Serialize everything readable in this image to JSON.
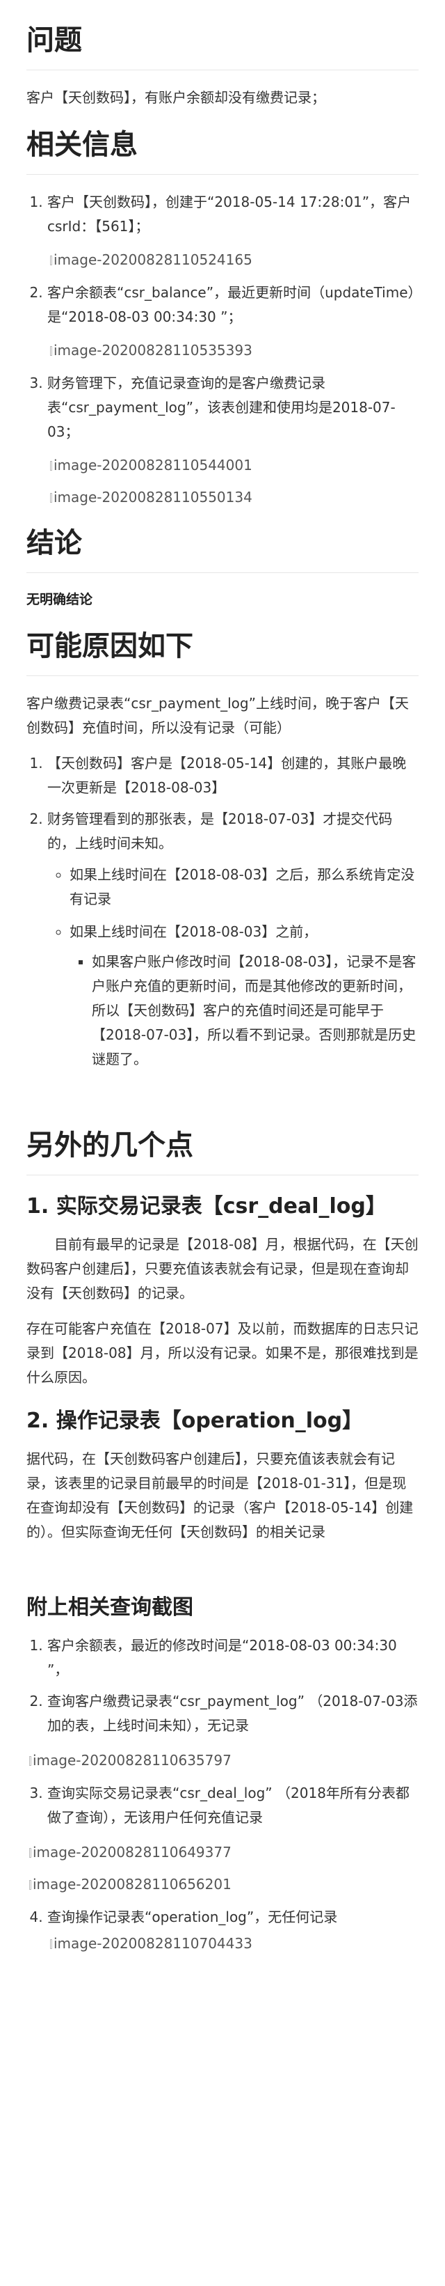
{
  "s1": {
    "title": "问题",
    "body": "客户【天创数码】，有账户余额却没有缴费记录；"
  },
  "s2": {
    "title": "相关信息",
    "items": [
      {
        "text": "客户【天创数码】，创建于“2018-05-14 17:28:01”，客户csrId：【561】；",
        "img": "image-20200828110524165"
      },
      {
        "text": "客户余额表“csr_balance”，最近更新时间（updateTime）是“2018-08-03 00:34:30 ”；",
        "img": "image-20200828110535393"
      },
      {
        "text": "财务管理下，充值记录查询的是客户缴费记录表“csr_payment_log”，该表创建和使用均是2018-07-03；",
        "img1": "image-20200828110544001",
        "img2": "image-20200828110550134"
      }
    ]
  },
  "s3": {
    "title": "结论",
    "body": "无明确结论"
  },
  "s4": {
    "title": "可能原因如下",
    "intro": "客户缴费记录表“csr_payment_log”上线时间，晚于客户【天创数码】充值时间，所以没有记录（可能）",
    "item1": "【天创数码】客户是【2018-05-14】创建的，其账户最晚一次更新是【2018-08-03】",
    "item2": "财务管理看到的那张表，是【2018-07-03】才提交代码的，上线时间未知。",
    "sub1": "如果上线时间在【2018-08-03】之后，那么系统肯定没有记录",
    "sub2": "如果上线时间在【2018-08-03】之前，",
    "subsub": "如果客户账户修改时间【2018-08-03】，记录不是客户账户充值的更新时间，而是其他修改的更新时间，所以【天创数码】客户的充值时间还是可能早于【2018-07-03】，所以看不到记录。否则那就是历史谜题了。"
  },
  "s5": {
    "title": "另外的几个点",
    "h_a": "1. 实际交易记录表【csr_deal_log】",
    "a_p1": "目前有最早的记录是【2018-08】月，根据代码，在【天创数码客户创建后】，只要充值该表就会有记录，但是现在查询却没有【天创数码】的记录。",
    "a_p2": "存在可能客户充值在【2018-07】及以前，而数据库的日志只记录到【2018-08】月，所以没有记录。如果不是，那很难找到是什么原因。",
    "h_b": "2. 操作记录表【operation_log】",
    "b_p1": "据代码，在【天创数码客户创建后】，只要充值该表就会有记录，该表里的记录目前最早的时间是【2018-01-31】，但是现在查询却没有【天创数码】的记录（客户【2018-05-14】创建的）。但实际查询无任何【天创数码】的相关记录"
  },
  "s6": {
    "title": "附上相关查询截图",
    "item1": "客户余额表，最近的修改时间是“2018-08-03 00:34:30 ”，",
    "item2": "查询客户缴费记录表“csr_payment_log” （2018-07-03添加的表，上线时间未知），无记录",
    "img2": "image-20200828110635797",
    "item3": "查询实际交易记录表“csr_deal_log” （2018年所有分表都做了查询），无该用户任何充值记录",
    "img3a": "image-20200828110649377",
    "img3b": "image-20200828110656201",
    "item4": "查询操作记录表“operation_log”，无任何记录",
    "img4": "image-20200828110704433"
  }
}
